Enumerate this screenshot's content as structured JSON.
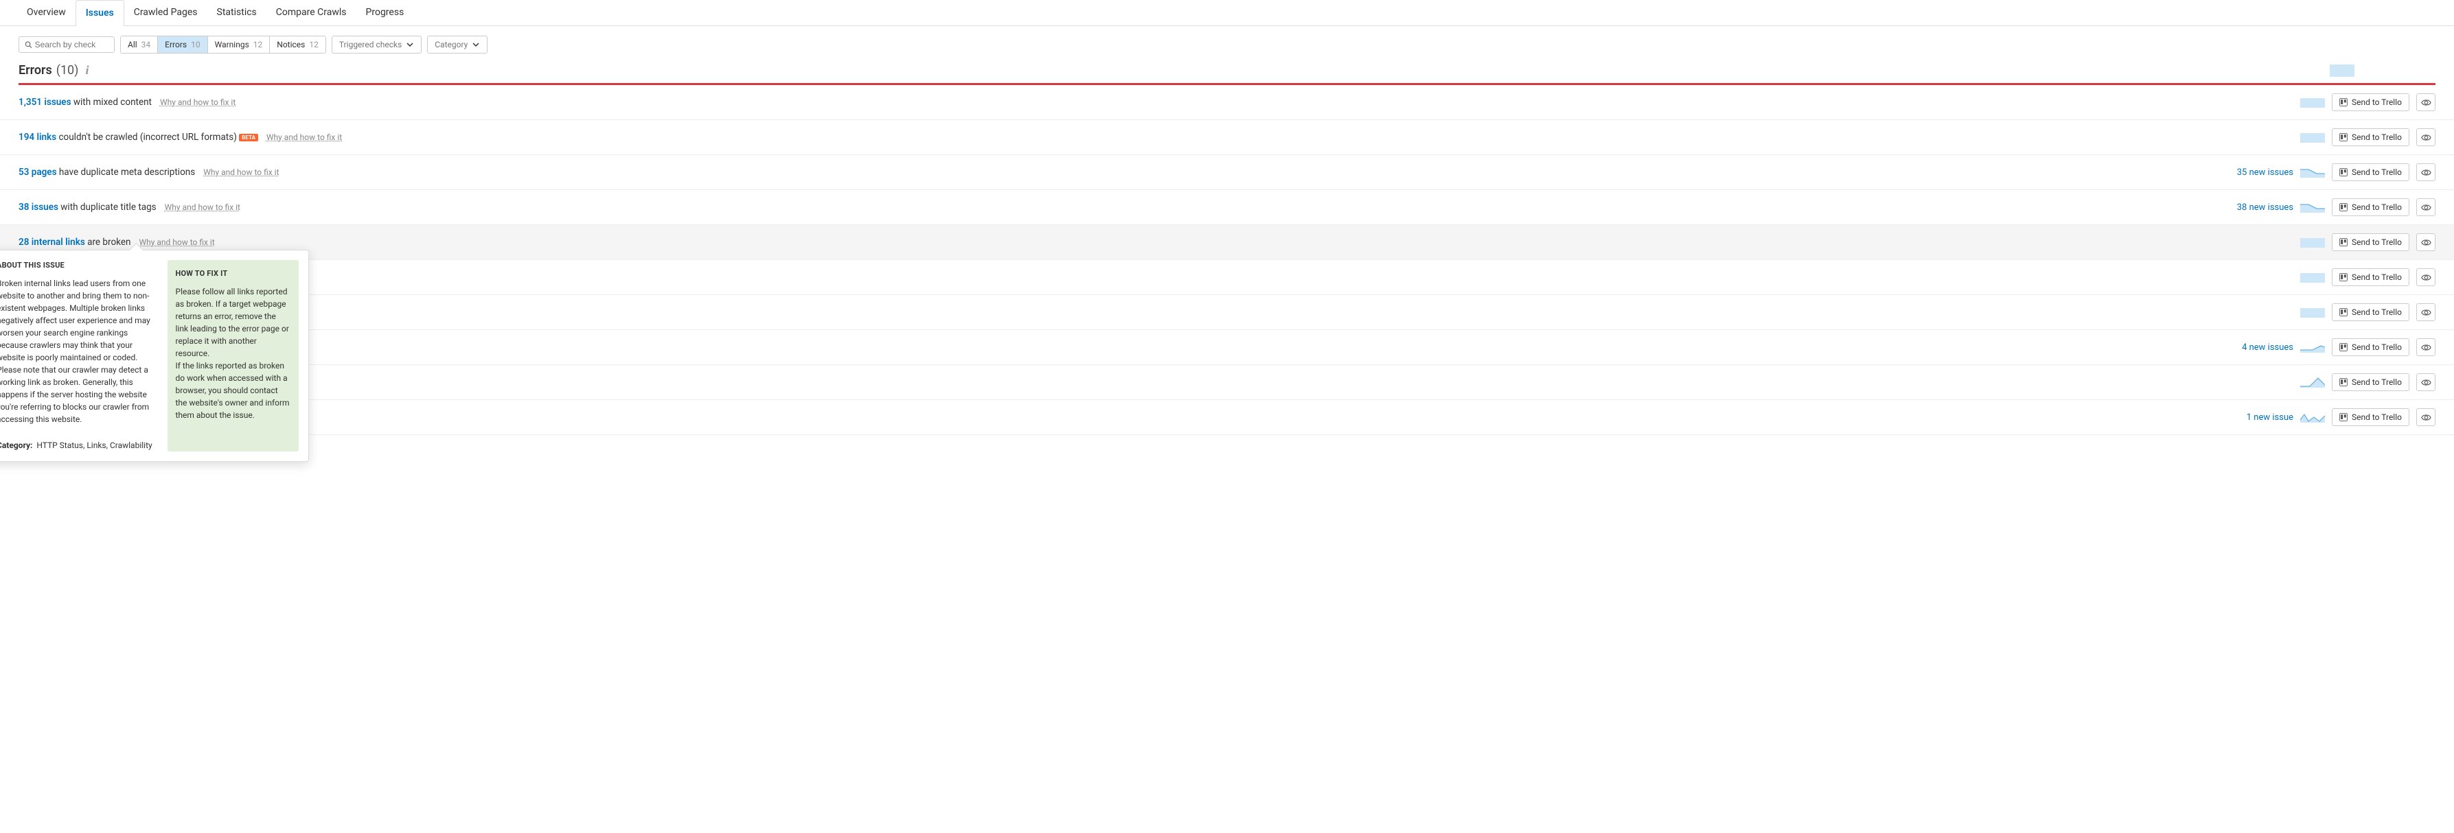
{
  "tabs": [
    "Overview",
    "Issues",
    "Crawled Pages",
    "Statistics",
    "Compare Crawls",
    "Progress"
  ],
  "active_tab": 1,
  "search_placeholder": "Search by check",
  "filters": [
    {
      "label": "All",
      "count": "34"
    },
    {
      "label": "Errors",
      "count": "10"
    },
    {
      "label": "Warnings",
      "count": "12"
    },
    {
      "label": "Notices",
      "count": "12"
    }
  ],
  "active_filter": 1,
  "dropdown1": "Triggered checks",
  "dropdown2": "Category",
  "section": {
    "title": "Errors",
    "count": "(10)"
  },
  "fix_link_label": "Why and how to fix it",
  "trello_label": "Send to Trello",
  "issues": [
    {
      "count": "1,351 issues",
      "rest": " with mixed content",
      "beta": false,
      "new": "",
      "spark": "flat"
    },
    {
      "count": "194 links",
      "rest": " couldn't be crawled (incorrect URL formats)",
      "beta": true,
      "new": "",
      "spark": "flat"
    },
    {
      "count": "53 pages",
      "rest": " have duplicate meta descriptions",
      "beta": false,
      "new": "35 new issues",
      "spark": "down"
    },
    {
      "count": "38 issues",
      "rest": " with duplicate title tags",
      "beta": false,
      "new": "38 new issues",
      "spark": "down"
    },
    {
      "count": "28 internal links",
      "rest": " are broken",
      "beta": false,
      "new": "",
      "spark": "flat",
      "hover": true,
      "popover": true
    },
    {
      "count": "",
      "rest": "",
      "beta": false,
      "new": "",
      "spark": "flat"
    },
    {
      "count": "",
      "rest": "",
      "beta": false,
      "new": "",
      "spark": "flat"
    },
    {
      "count": "",
      "rest": "",
      "beta": false,
      "new": "4 new issues",
      "spark": "up"
    },
    {
      "count": "",
      "rest": "",
      "beta": false,
      "new": "",
      "spark": "peak"
    },
    {
      "count": "",
      "rest": "",
      "beta": false,
      "new": "1 new issue",
      "spark": "zig"
    }
  ],
  "popover": {
    "about_h": "ABOUT THIS ISSUE",
    "about_p1": "Broken internal links lead users from one website to another and bring them to non-existent webpages. Multiple broken links negatively affect user experience and may worsen your search engine rankings because crawlers may think that your website is poorly maintained or coded.",
    "about_p2": "Please note that our crawler may detect a working link as broken. Generally, this happens if the server hosting the website you're referring to blocks our crawler from accessing this website.",
    "cat_label": "Category:",
    "cat_value": "HTTP Status, Links, Crawlability",
    "fix_h": "HOW TO FIX IT",
    "fix_p1": "Please follow all links reported as broken. If a target webpage returns an error, remove the link leading to the error page or replace it with another resource.",
    "fix_p2": "If the links reported as broken do work when accessed with a browser, you should contact the website's owner and inform them about the issue."
  },
  "beta_text": "BETA"
}
